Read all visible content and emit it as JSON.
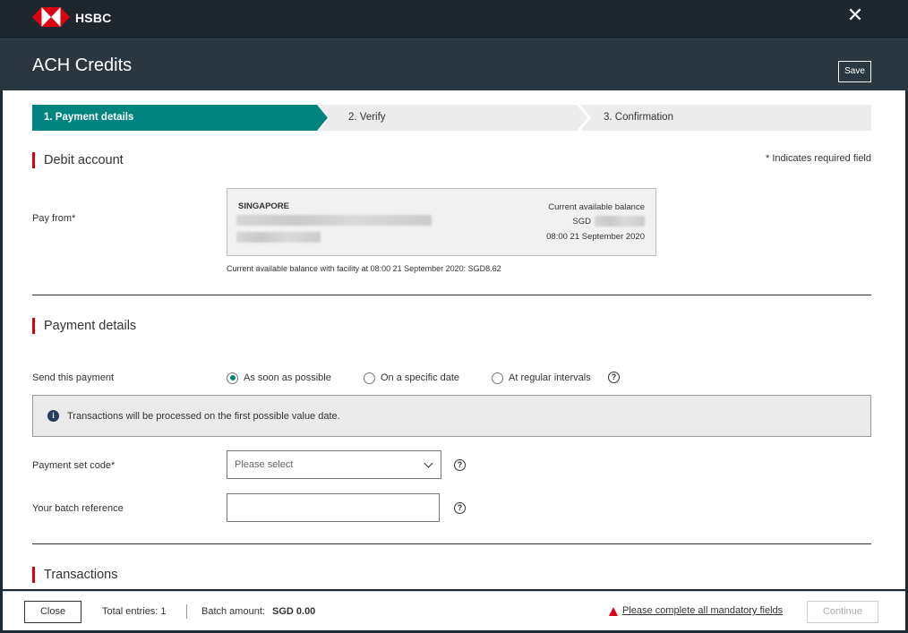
{
  "header": {
    "brand": "HSBC",
    "close_icon": "close-icon",
    "title": "ACH Credits",
    "save_label": "Save"
  },
  "stepper": {
    "steps": [
      {
        "label": "1. Payment details",
        "state": "active"
      },
      {
        "label": "2. Verify",
        "state": "inactive"
      },
      {
        "label": "3. Confirmation",
        "state": "inactive"
      }
    ],
    "active_color": "#00847f"
  },
  "debit": {
    "heading": "Debit account",
    "required_note": "* Indicates required field",
    "pay_from_label": "Pay from*",
    "account": {
      "country": "SINGAPORE",
      "balance_label": "Current available balance",
      "currency": "SGD",
      "timestamp": "08:00 21 September 2020"
    },
    "facility_note": "Current available balance with facility at 08:00 21 September 2020: SGD8.62"
  },
  "payment": {
    "heading": "Payment details",
    "send_label": "Send this payment",
    "options": [
      {
        "label": "As soon as possible",
        "checked": true
      },
      {
        "label": "On a specific date",
        "checked": false
      },
      {
        "label": "At regular intervals",
        "checked": false
      }
    ],
    "info_text": "Transactions will be processed on the first possible value date.",
    "set_code_label": "Payment set code*",
    "set_code_placeholder": "Please select",
    "batch_ref_label": "Your batch reference",
    "batch_ref_value": ""
  },
  "transactions": {
    "heading": "Transactions"
  },
  "footer": {
    "close_label": "Close",
    "total_entries": "Total entries: 1",
    "batch_amount_label": "Batch amount:",
    "batch_amount_value": "SGD 0.00",
    "warning_text": "Please complete all mandatory fields",
    "continue_label": "Continue"
  },
  "colors": {
    "brand_red": "#db0011",
    "accent_teal": "#00847f",
    "header_dark": "#1d2730"
  }
}
